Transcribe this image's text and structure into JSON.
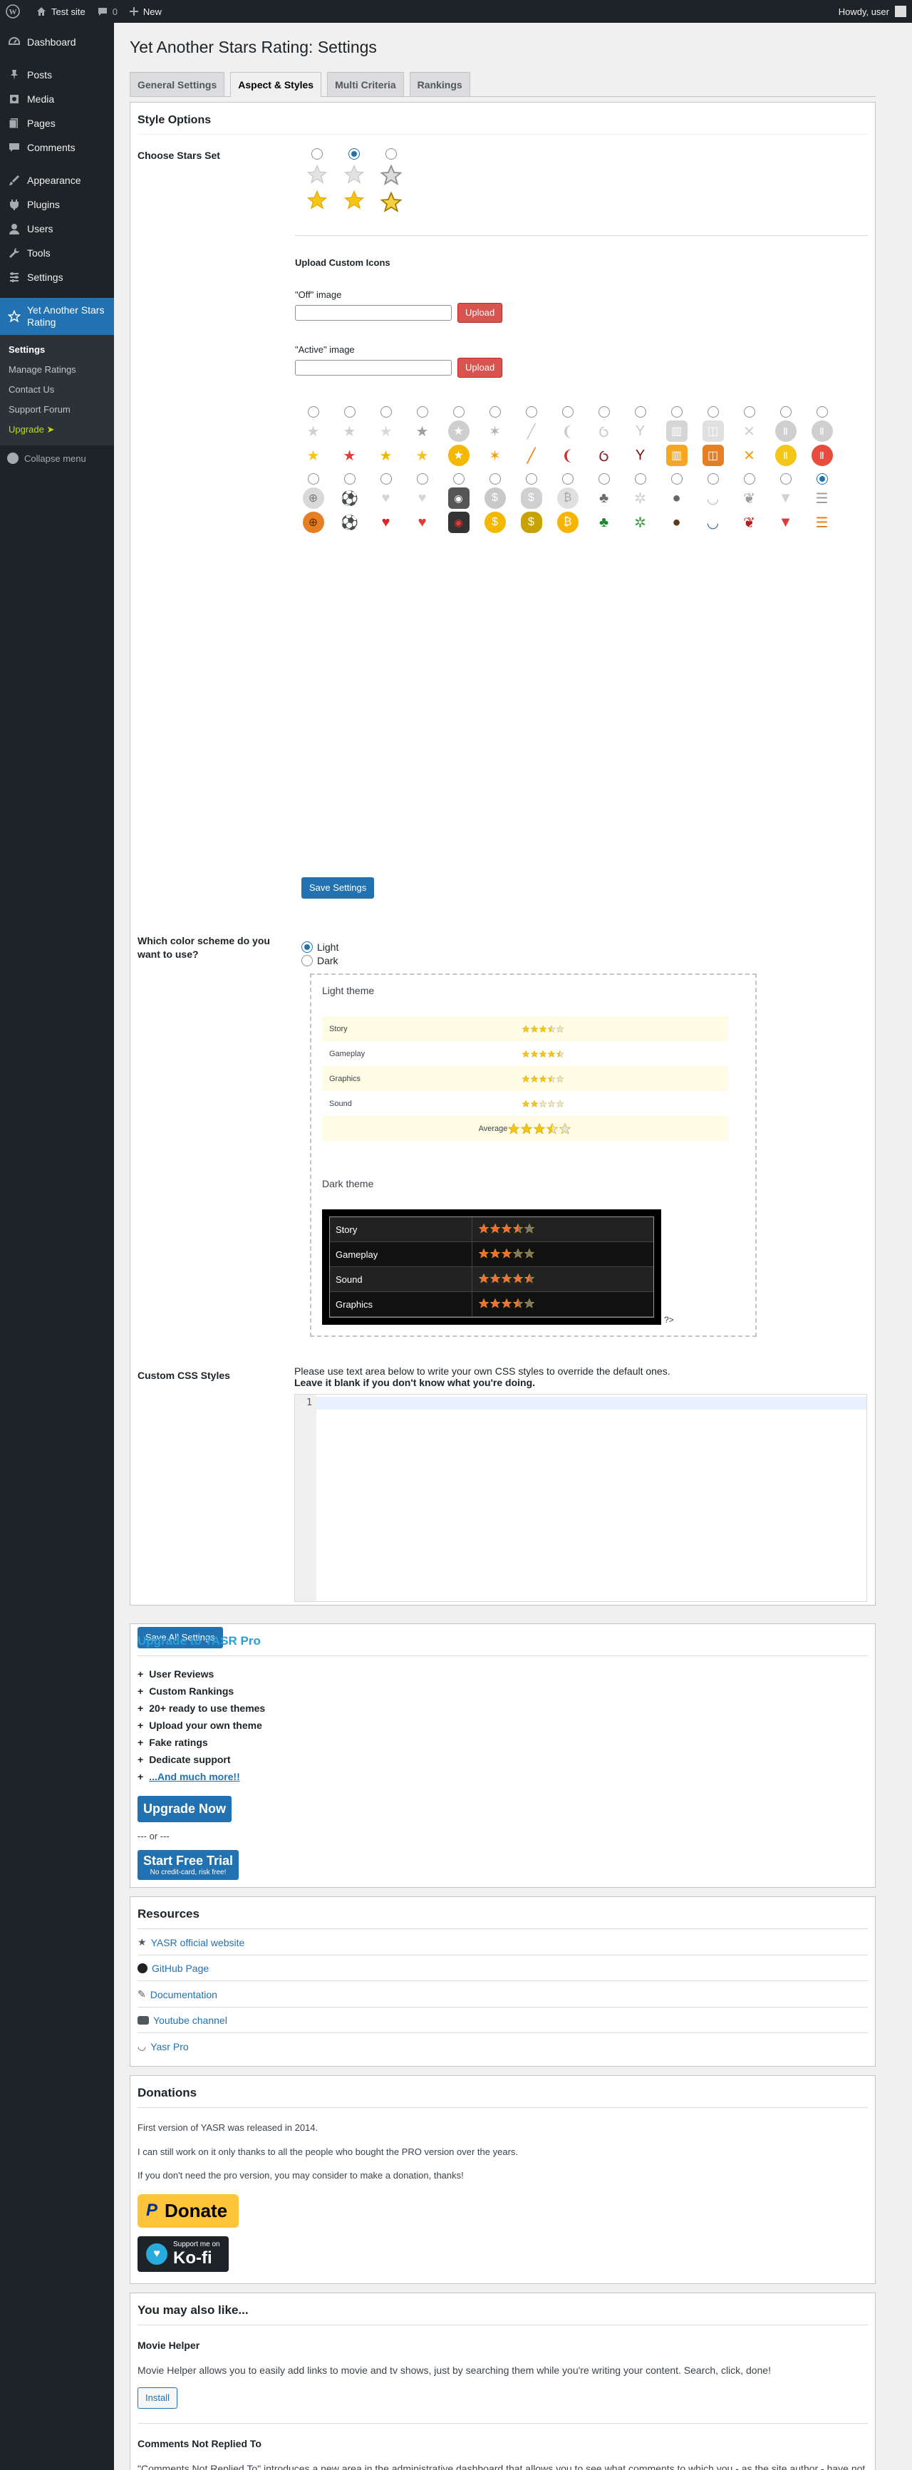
{
  "adminbar": {
    "site_name": "Test site",
    "comments_count": "0",
    "new_label": "New",
    "howdy": "Howdy, user"
  },
  "sidebar": {
    "items": [
      {
        "label": "Dashboard",
        "icon": "dashboard-icon"
      },
      {
        "label": "Posts",
        "icon": "pin-icon"
      },
      {
        "label": "Media",
        "icon": "media-icon"
      },
      {
        "label": "Pages",
        "icon": "page-icon"
      },
      {
        "label": "Comments",
        "icon": "comment-icon"
      },
      {
        "label": "Appearance",
        "icon": "brush-icon"
      },
      {
        "label": "Plugins",
        "icon": "plug-icon"
      },
      {
        "label": "Users",
        "icon": "user-icon"
      },
      {
        "label": "Tools",
        "icon": "wrench-icon"
      },
      {
        "label": "Settings",
        "icon": "settings-icon"
      },
      {
        "label": "Yet Another Stars Rating",
        "icon": "star-icon"
      }
    ],
    "submenu": [
      "Settings",
      "Manage Ratings",
      "Contact Us",
      "Support Forum",
      "Upgrade"
    ],
    "upgrade_arrow": "➤",
    "collapse": "Collapse menu"
  },
  "page": {
    "title": "Yet Another Stars Rating: Settings",
    "tabs": [
      "General Settings",
      "Aspect & Styles",
      "Multi Criteria",
      "Rankings"
    ]
  },
  "style_options": {
    "heading": "Style Options",
    "choose_stars_label": "Choose Stars Set",
    "upload_title": "Upload Custom Icons",
    "off_label": "\"Off\" image",
    "active_label": "\"Active\" image",
    "upload_button": "Upload",
    "save_settings": "Save Settings"
  },
  "color_scheme": {
    "label": "Which color scheme do you want to use?",
    "options": [
      "Light",
      "Dark"
    ],
    "light_theme_label": "Light theme",
    "light_rows": [
      {
        "name": "Story",
        "rating": 3.5
      },
      {
        "name": "Gameplay",
        "rating": 4.5
      },
      {
        "name": "Graphics",
        "rating": 3.5
      },
      {
        "name": "Sound",
        "rating": 2
      }
    ],
    "average_label": "Average",
    "average_rating": 3.5,
    "dark_theme_label": "Dark theme",
    "dark_rows": [
      {
        "name": "Story",
        "rating": 3.5
      },
      {
        "name": "Gameplay",
        "rating": 3
      },
      {
        "name": "Sound",
        "rating": 4.5
      },
      {
        "name": "Graphics",
        "rating": 3.5
      }
    ],
    "dark_suffix": "?>"
  },
  "custom_css": {
    "label": "Custom CSS Styles",
    "help_line1": "Please use text area below to write your own CSS styles to override the default ones.",
    "help_line2": "Leave it blank if you don't know what you're doing.",
    "line_number": "1",
    "save_all": "Save All Settings"
  },
  "upgrade_box": {
    "title": "Upgrade to YASR Pro",
    "features": [
      "User Reviews",
      "Custom Rankings",
      "20+ ready to use themes",
      "Upload your own theme",
      "Fake ratings",
      "Dedicate support"
    ],
    "more_link": "...And much more!!",
    "upgrade_now": "Upgrade Now",
    "or_text": "--- or ---",
    "trial_title": "Start Free Trial",
    "trial_sub": "No credit-card, risk free!"
  },
  "resources": {
    "title": "Resources",
    "items": [
      {
        "label": "YASR official website",
        "icon": "star-icon"
      },
      {
        "label": "GitHub Page",
        "icon": "github-icon"
      },
      {
        "label": "Documentation",
        "icon": "edit-icon"
      },
      {
        "label": "Youtube channel",
        "icon": "video-icon"
      },
      {
        "label": "Yasr Pro",
        "icon": "smile-icon"
      }
    ]
  },
  "donations": {
    "title": "Donations",
    "p1": "First version of YASR was released in 2014.",
    "p2": "I can still work on it only thanks to all the people who bought the PRO version over the years.",
    "p3": "If you don't need the pro version, you may consider to make a donation, thanks!",
    "donate_label": "Donate",
    "kofi_sup": "Support me on",
    "kofi_name": "Ko-fi"
  },
  "also_like": {
    "title": "You may also like...",
    "plugin1_name": "Movie Helper",
    "plugin1_desc": "Movie Helper allows you to easily add links to movie and tv shows, just by searching them while you're writing your content. Search, click, done!",
    "install_label": "Install",
    "plugin2_name": "Comments Not Replied To",
    "plugin2_desc": "\"Comments Not Replied To\" introduces a new area in the administrative dashboard that allows you to see what comments to which you - as the site author - have not yet replied."
  },
  "colors": {
    "admin_dark": "#1d2327",
    "accent_blue": "#2271b1",
    "upload_red": "#d9534f",
    "star_yellow": "#f5c518",
    "dark_star": "#ff6b3d",
    "donate_yellow": "#ffc439"
  }
}
